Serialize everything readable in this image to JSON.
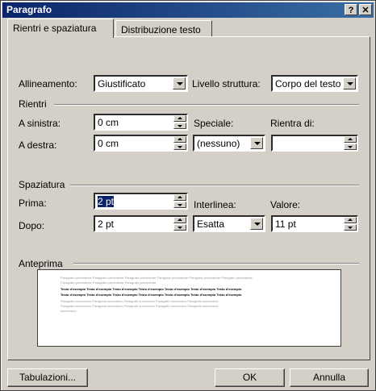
{
  "window": {
    "title": "Paragrafo",
    "help": "?",
    "close": "✕"
  },
  "tabs": [
    {
      "label": "Rientri e spaziatura",
      "active": true
    },
    {
      "label": "Distribuzione testo",
      "active": false
    }
  ],
  "alignment": {
    "label": "Allineamento:",
    "value": "Giustificato"
  },
  "outline": {
    "label": "Livello struttura:",
    "value": "Corpo del testo"
  },
  "indent": {
    "section": "Rientri",
    "left_label": "A sinistra:",
    "left_value": "0 cm",
    "right_label": "A destra:",
    "right_value": "0 cm",
    "special_label": "Speciale:",
    "special_value": "(nessuno)",
    "by_label": "Rientra di:",
    "by_value": ""
  },
  "spacing": {
    "section": "Spaziatura",
    "before_label": "Prima:",
    "before_value": "2 pt",
    "after_label": "Dopo:",
    "after_value": "2 pt",
    "line_label": "Interlinea:",
    "line_value": "Esatta",
    "at_label": "Valore:",
    "at_value": "11 pt"
  },
  "preview": {
    "section": "Anteprima",
    "prev_line1": "Paragrafo precedente Paragrafo precedente Paragrafo precedente Paragrafo precedente Paragrafo precedente Paragrafo precedente",
    "prev_line2": "Paragrafo precedente Paragrafo precedente Paragrafo precedente",
    "sample_line1": "Testo d'esempio Testo d'esempio Testo d'esempio Testo d'esempio Testo d'esempio Testo d'esempio Testo d'esempio",
    "sample_line2": "Testo d'esempio Testo d'esempio Testo d'esempio Testo d'esempio Testo d'esempio Testo d'esempio Testo d'esempio",
    "next_line1": "Paragrafo successivo Paragrafo successivo Paragrafo successivo Paragrafo successivo Paragrafo successivo",
    "next_line2": "Paragrafo successivo Paragrafo successivo Paragrafo successivo Paragrafo successivo Paragrafo successivo",
    "next_line3": "successivo"
  },
  "buttons": {
    "tabs": "Tabulazioni...",
    "ok": "OK",
    "cancel": "Annulla"
  }
}
